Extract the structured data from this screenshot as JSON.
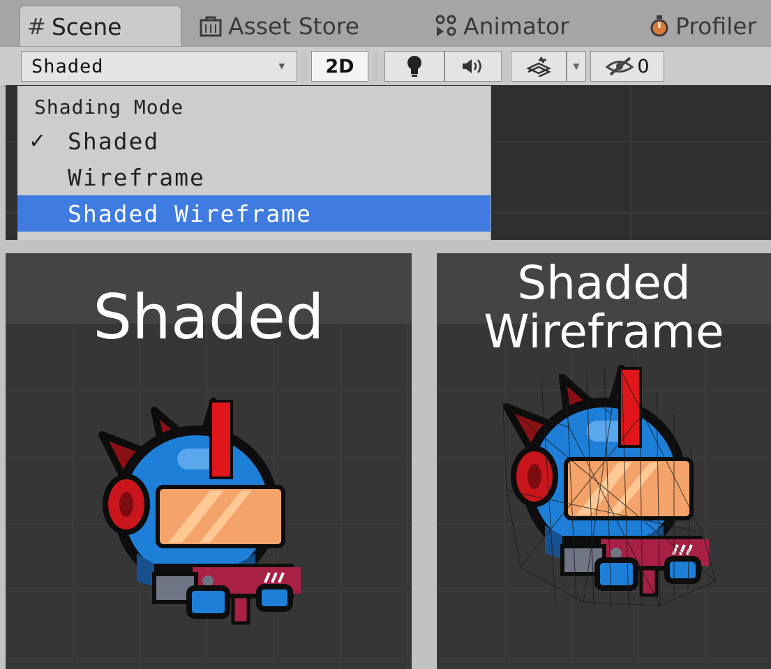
{
  "tabs": [
    {
      "label": "Scene",
      "icon": "grid-icon"
    },
    {
      "label": "Asset Store",
      "icon": "bag-icon"
    },
    {
      "label": "Animator",
      "icon": "animator-icon"
    },
    {
      "label": "Profiler",
      "icon": "stopwatch-icon"
    }
  ],
  "toolbar": {
    "shading_value": "Shaded",
    "two_d_label": "2D",
    "hidden_count": "0"
  },
  "shading_menu": {
    "header": "Shading Mode",
    "check_mark": "✓",
    "items": [
      {
        "label": "Shaded",
        "checked": true
      },
      {
        "label": "Wireframe",
        "checked": false
      },
      {
        "label": "Shaded Wireframe",
        "highlighted": true
      }
    ]
  },
  "comparison": {
    "left_title": "Shaded",
    "right_title_line1": "Shaded",
    "right_title_line2": "Wireframe"
  },
  "colors": {
    "menu_highlight": "#3f7be1",
    "scene_bg": "#363636",
    "helmet_blue": "#1e7fd8",
    "visor_orange": "#f4a46a",
    "crest_red": "#e0161b",
    "gun_red": "#a82145"
  }
}
